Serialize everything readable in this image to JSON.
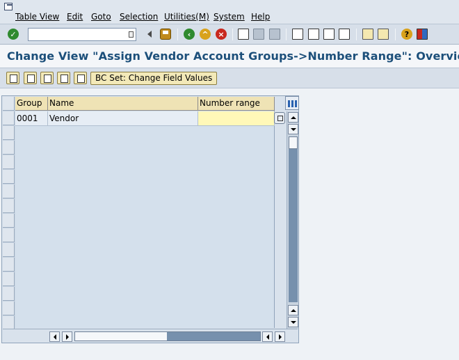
{
  "menubar": {
    "items": [
      "Table View",
      "Edit",
      "Goto",
      "Selection",
      "Utilities(M)",
      "System",
      "Help"
    ]
  },
  "toolbar": {
    "command_field_value": "",
    "icons": [
      "enter-icon",
      "back-arrow-icon",
      "save-icon",
      "back-icon",
      "exit-icon",
      "cancel-icon",
      "print-icon",
      "find-icon",
      "find-next-icon",
      "first-page-icon",
      "previous-page-icon",
      "next-page-icon",
      "last-page-icon",
      "create-session-icon",
      "shortcut-icon",
      "help-icon",
      "layout-icon"
    ]
  },
  "title": "Change View \"Assign Vendor Account Groups->Number Range\": Overview",
  "app_toolbar": {
    "bcset_label": "BC Set: Change Field Values"
  },
  "table": {
    "columns": [
      "Group",
      "Name",
      "Number range"
    ],
    "rows": [
      {
        "group": "0001",
        "name": "Vendor",
        "number_range": ""
      }
    ]
  },
  "colors": {
    "title": "#1c4f7a",
    "header_bg": "#efe3b5",
    "input_bg": "#fff8b8",
    "scroll_track": "#7690ad"
  }
}
